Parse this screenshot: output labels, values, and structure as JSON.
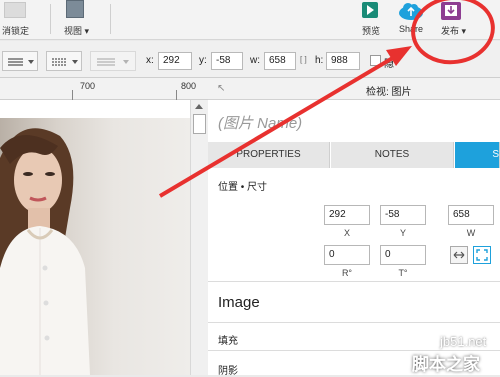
{
  "topbar": {
    "unlock_label": "消锁定",
    "view_label": "视图 ▾",
    "preview_label": "预览",
    "share_label": "Share",
    "publish_label": "发布 ▾"
  },
  "toolbar": {
    "x_label": "x:",
    "x_value": "292",
    "y_label": "y:",
    "y_value": "-58",
    "w_label": "w:",
    "w_value": "658",
    "lock_glyph": "[ ]",
    "h_label": "h:",
    "h_value": "988",
    "hidden_label": "隐"
  },
  "ruler": {
    "tick_700": "700",
    "tick_800": "800"
  },
  "panel": {
    "header_title": "检视: 图片",
    "name_placeholder": "(图片 Name)",
    "tabs": [
      "PROPERTIES",
      "NOTES",
      "S"
    ],
    "section_title": "位置 • 尺寸",
    "x_value": "292",
    "x_caption": "X",
    "y_value": "-58",
    "y_caption": "Y",
    "w_value": "658",
    "w_caption": "W",
    "r_value": "0",
    "r_caption": "R°",
    "t_value": "0",
    "t_caption": "T°",
    "image_heading": "Image",
    "fill_label": "填充",
    "shadow_label": "阴影"
  },
  "watermark": {
    "line1": "jb51.net",
    "line2": "脚本之家"
  },
  "colors": {
    "accent": "#1ea1dc",
    "annotation": "#e8312f",
    "publish_icon": "#8d3d91",
    "preview_icon": "#1a8b77"
  }
}
